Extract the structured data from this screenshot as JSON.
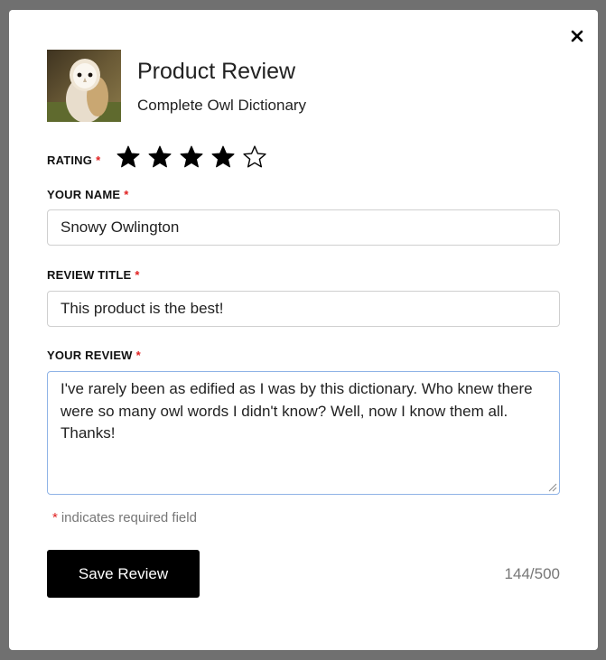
{
  "modal": {
    "title": "Product Review",
    "product_name": "Complete Owl Dictionary",
    "thumbnail_icon": "barn-owl-photo",
    "close_icon": "close-icon"
  },
  "form": {
    "rating": {
      "label": "RATING",
      "required_mark": "*",
      "value": 4,
      "max": 5
    },
    "name": {
      "label": "YOUR NAME",
      "required_mark": "*",
      "value": "Snowy Owlington"
    },
    "review_title": {
      "label": "REVIEW TITLE",
      "required_mark": "*",
      "value": "This product is the best!"
    },
    "review": {
      "label": "YOUR REVIEW",
      "required_mark": "*",
      "value": "I've rarely been as edified as I was by this dictionary. Who knew there were so many owl words I didn't know? Well, now I know them all. Thanks!"
    },
    "required_note": {
      "mark": "*",
      "text": "indicates required field"
    },
    "save_label": "Save Review",
    "char_count": "144/500"
  },
  "colors": {
    "required": "#e02020",
    "button_bg": "#000000",
    "focus_border": "#8fb3e6"
  }
}
